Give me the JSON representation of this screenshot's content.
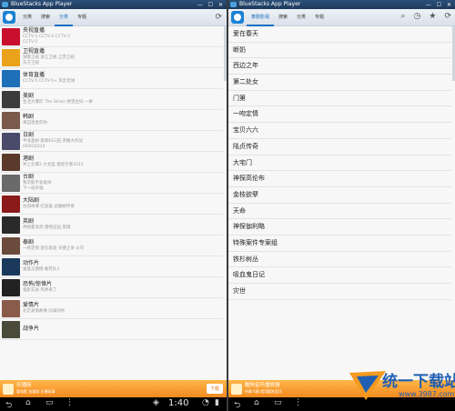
{
  "left": {
    "window_title": "BlueStacks App Player",
    "tabs": [
      "分类",
      "搜索",
      "分类",
      "专题"
    ],
    "active_tab": 2,
    "items": [
      {
        "title": "央视直播",
        "sub1": "CCTV-1 CCTV-2 CCTV-3",
        "sub2": "CCTV-5",
        "color": "#c8102e"
      },
      {
        "title": "卫视直播",
        "sub1": "湖南卫视 浙江卫视 江苏卫视",
        "sub2": "东方卫视",
        "color": "#e9a21a"
      },
      {
        "title": "体育直播",
        "sub1": "CCTV-5 CCTV-5+ 风云足球",
        "sub2": "",
        "color": "#1d6fb8"
      },
      {
        "title": "美剧",
        "sub1": "生活大爆炸 The Strain 绝望主妇 一季",
        "sub2": "",
        "color": "#3c3c3c"
      },
      {
        "title": "韩剧",
        "sub1": "来自星星的你 ",
        "sub2": "",
        "color": "#7a5a4a"
      },
      {
        "title": "日剧",
        "sub1": "半泽直树 家政妇三田 求婚大作战",
        "sub2": "HERO2014",
        "color": "#4a4a6a"
      },
      {
        "title": "港剧",
        "sub1": "冲上云霄2 大太监 使徒行者2013",
        "sub2": "",
        "color": "#5a3b2b"
      },
      {
        "title": "台剧",
        "sub1": "我可能不会爱你 ",
        "sub2": "下一站幸福",
        "color": "#6a6a6a"
      },
      {
        "title": "大陆剧",
        "sub1": "古剑奇谭 红高粱 武媚娘传奇",
        "sub2": "",
        "color": "#8b1a1a"
      },
      {
        "title": "英剧",
        "sub1": "神探夏洛克 唐顿庄园 黑镜",
        "sub2": "",
        "color": "#2a2a2a"
      },
      {
        "title": "泰剧",
        "sub1": "一吻定情 爱在旅途 天使之争 火鸟",
        "sub2": "",
        "color": "#6b4b3b"
      },
      {
        "title": "动作片",
        "sub1": "速度与激情 敢死队3",
        "sub2": "",
        "color": "#1b3a5b"
      },
      {
        "title": "恐怖/惊悚片",
        "sub1": "鬼影实录 死神来了",
        "sub2": "",
        "color": "#222222"
      },
      {
        "title": "爱情片",
        "sub1": "北京爱情故事 同桌的你 ",
        "sub2": "",
        "color": "#8a5a4a"
      },
      {
        "title": "战争片",
        "sub1": "",
        "sub2": "",
        "color": "#4a4a3a"
      }
    ],
    "banner": {
      "title": "乐播网",
      "sub": "看电影 追美剧 乐播高清",
      "button": "下载"
    },
    "clock": "1:40"
  },
  "right": {
    "window_title": "BlueStacks App Player",
    "app_name": "泰剧影视",
    "tabs": [
      "搜索",
      "分类",
      "专题"
    ],
    "items": [
      "爱在春天",
      "断奶",
      "西边之年",
      "第二处女",
      "门第",
      "一吻定情",
      "宝贝六六",
      "陆贞传奇",
      "大宅门",
      "神探高伦布",
      "金枝欲孽",
      "天命",
      "神探伽利略",
      "特殊案件专案组",
      "铁杉树丛",
      "吸血鬼日记",
      "灾世"
    ],
    "banner": {
      "title": "酷狗音乐播放器",
      "sub": "听歌 K歌 就用酷狗音乐"
    },
    "clock": "1:40"
  },
  "watermark": {
    "text": "统一下载站",
    "url": "www.3987.com"
  },
  "colors": {
    "accent": "#1a6fc4",
    "banner": "#f28a1e",
    "titlebar": "#1e3a5c",
    "navbar": "#000000"
  }
}
